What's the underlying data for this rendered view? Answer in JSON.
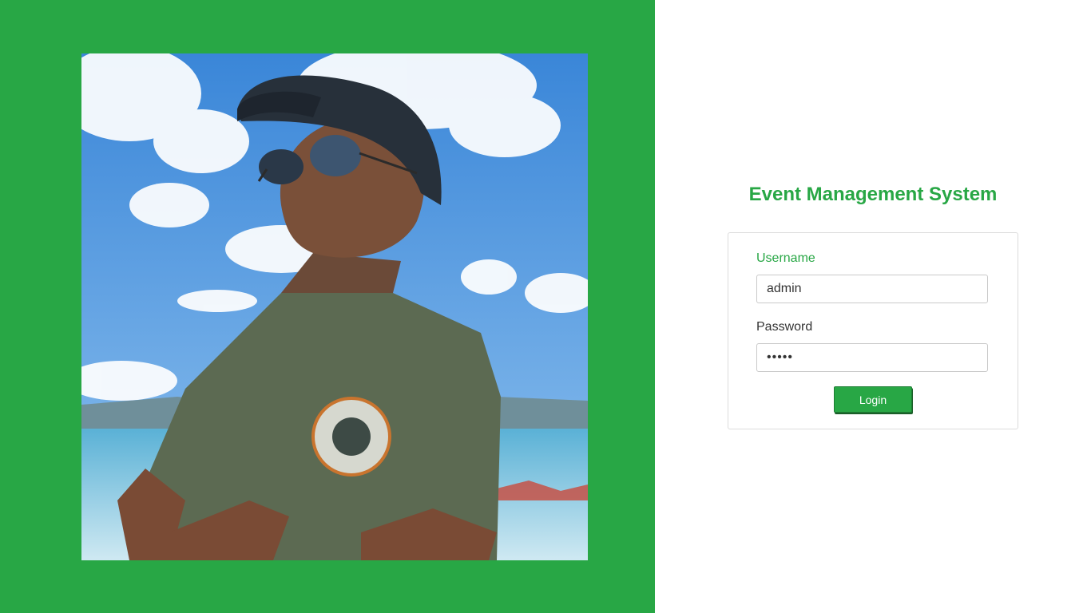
{
  "app": {
    "title": "Event Management System"
  },
  "login_form": {
    "username_label": "Username",
    "username_value": "admin",
    "password_label": "Password",
    "password_value": "admin",
    "login_button_label": "Login"
  },
  "theme": {
    "accent_color": "#28a745",
    "background_color": "#ffffff"
  },
  "photo": {
    "subject": "person-in-cap-and-sunglasses-at-beach"
  }
}
